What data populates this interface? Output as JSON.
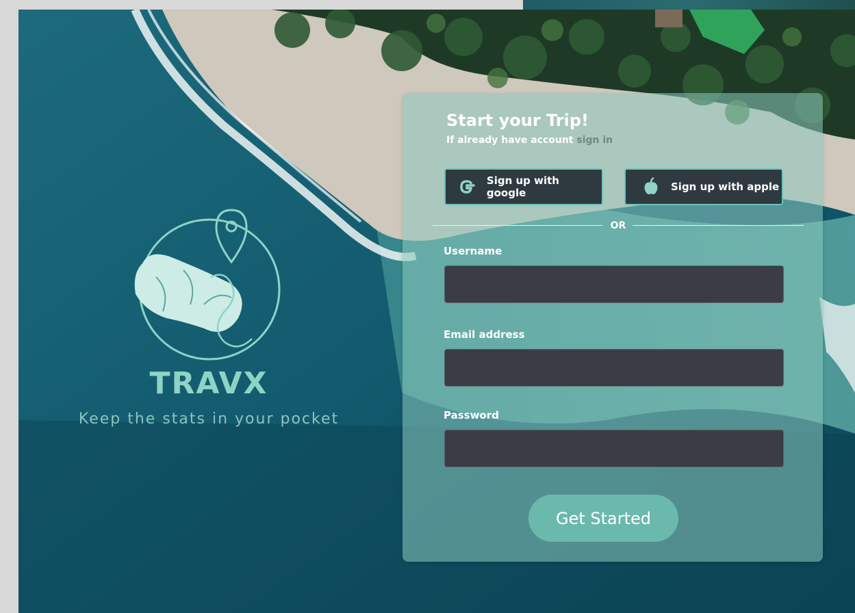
{
  "brand": {
    "name": "TRAVX",
    "tagline": "Keep the stats in your pocket"
  },
  "form": {
    "title": "Start your Trip!",
    "subtitle_prefix": "If already have account ",
    "signin_link": "sign in",
    "google_button": "Sign up with google",
    "apple_button": "Sign up with apple",
    "divider": "OR",
    "fields": [
      {
        "label": "Username",
        "value": "",
        "placeholder": ""
      },
      {
        "label": "Email address",
        "value": "",
        "placeholder": ""
      },
      {
        "label": "Password",
        "value": "",
        "placeholder": ""
      }
    ],
    "submit": "Get Started"
  },
  "icons": {
    "google": "google-icon",
    "apple": "apple-icon",
    "logo": "globe-map-pin-logo"
  },
  "colors": {
    "accent": "#6bb9ad",
    "brand_text": "#8fd3c5",
    "input_bg": "#3a3d46",
    "button_bg": "#2f3a40"
  }
}
